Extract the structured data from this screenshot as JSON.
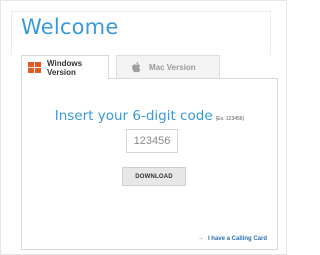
{
  "header": {
    "title": "Welcome"
  },
  "tabs": [
    {
      "label": "Windows Version",
      "icon": "windows-icon",
      "active": true
    },
    {
      "label": "Mac Version",
      "icon": "apple-icon",
      "active": false
    }
  ],
  "form": {
    "insert_label": "Insert your 6-digit code",
    "example": "(Ex. 123456)",
    "code_placeholder": "123456",
    "code_value": ""
  },
  "actions": {
    "download_label": "DOWNLOAD",
    "calling_card_label": "I have a Calling Card"
  },
  "colors": {
    "accent": "#3a9ad9",
    "link": "#2a6fb0",
    "button_bg": "#e7e7e7"
  }
}
